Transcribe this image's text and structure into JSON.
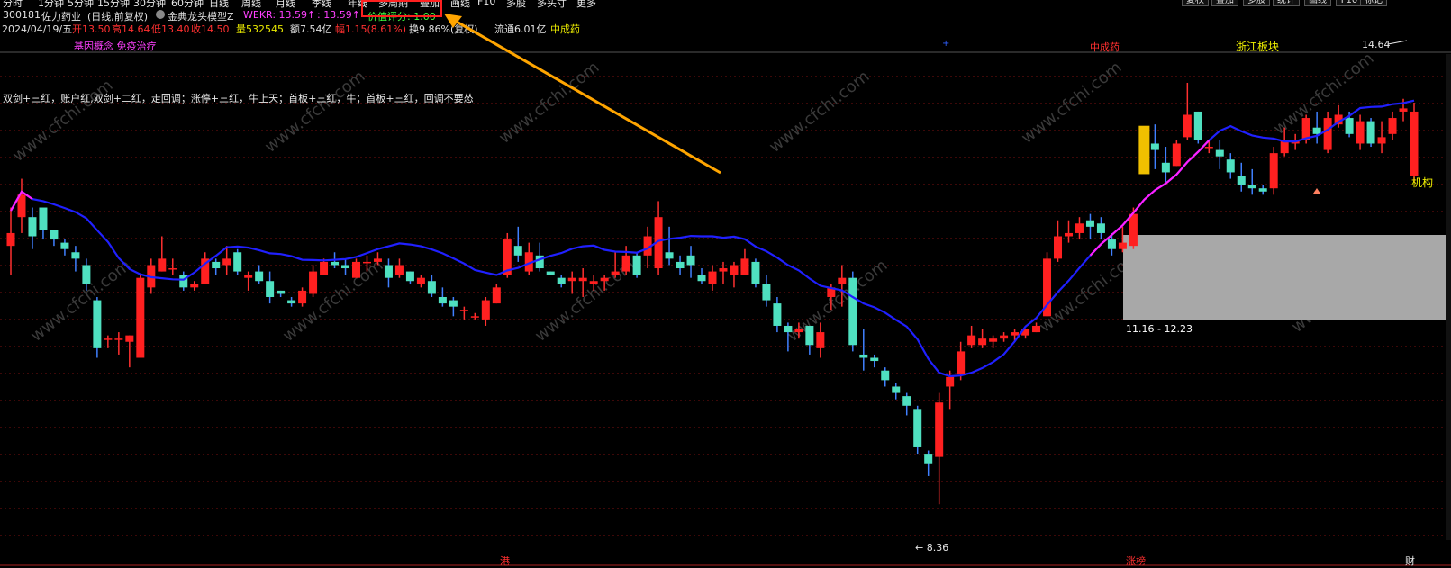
{
  "menubar": {
    "items": [
      "分时",
      "1分钟",
      "5分钟",
      "15分钟",
      "30分钟",
      "60分钟",
      "日线",
      "周线",
      "月线",
      "季线",
      "年线",
      "多周期",
      "叠加",
      "画线",
      "F10",
      "多股",
      "多头寸",
      "更多"
    ],
    "right_buttons": [
      "复权",
      "叠加",
      "多股",
      "统计",
      "画线",
      "F10",
      "标记"
    ]
  },
  "header": {
    "code": "300181",
    "name": "佐力药业",
    "period": "(日线,前复权)",
    "indicator": "金典龙头模型Z",
    "wekr_label": "WEKR: 13.59↑",
    "wekr_value": ": 13.59↑",
    "score": "价值评分: 1.00",
    "date": "2024/04/19/五",
    "open": "开13.50",
    "high": "高14.64",
    "low": "低13.40",
    "close": "收14.50",
    "volume": "量532545",
    "amount": "额7.54亿",
    "change": "幅1.15(8.61%)",
    "turnover": "换9.86%(复权)",
    "float": "流通6.01亿",
    "sector": "中成药"
  },
  "chart_labels": {
    "concepts": "基因概念 免疫治疗",
    "sector_tag": "中成药",
    "region_tag": "浙江板块",
    "strategy": "双剑+三红，账户红,双剑+二红，走回调；涨停+三红，牛上天；首板+三红，牛；首板+三红，回调不要怂",
    "high_mark": "14.64",
    "low_mark": "8.36",
    "range_label": "11.16 - 12.23",
    "jigou": "机构",
    "bottom_gang": "港",
    "bottom_zhangtingbang": "涨榜",
    "bottom_cai": "财",
    "watermark": "www.cfchi.com"
  },
  "colors": {
    "up": "#ff2020",
    "down": "#4fe0c0",
    "ma_blue": "#2020ff",
    "ma_magenta": "#ff20ff",
    "grid": "#7a1010",
    "arrow": "#ffa500"
  },
  "chart_data": {
    "type": "candlestick",
    "y_range": [
      7.8,
      15.4
    ],
    "candles": [
      [
        12.4,
        13.0,
        11.95,
        12.6
      ],
      [
        12.85,
        13.45,
        12.6,
        13.2
      ],
      [
        12.85,
        13.0,
        12.35,
        12.55
      ],
      [
        13.0,
        12.95,
        12.5,
        12.65
      ],
      [
        12.65,
        12.65,
        12.4,
        12.5
      ],
      [
        12.45,
        12.5,
        12.25,
        12.35
      ],
      [
        12.3,
        12.4,
        12.0,
        12.2
      ],
      [
        12.1,
        12.2,
        11.7,
        11.8
      ],
      [
        11.55,
        11.6,
        10.65,
        10.8
      ],
      [
        10.95,
        11.0,
        10.8,
        10.95
      ],
      [
        10.95,
        11.05,
        10.7,
        10.95
      ],
      [
        10.9,
        11.0,
        10.5,
        11.0
      ],
      [
        10.65,
        11.95,
        10.65,
        11.9
      ],
      [
        11.75,
        12.2,
        11.65,
        12.1
      ],
      [
        12.0,
        12.55,
        12.0,
        12.2
      ],
      [
        12.05,
        12.2,
        11.95,
        12.05
      ],
      [
        11.95,
        12.0,
        11.7,
        11.75
      ],
      [
        11.75,
        11.85,
        11.7,
        11.8
      ],
      [
        11.8,
        12.3,
        11.8,
        12.2
      ],
      [
        12.15,
        12.2,
        11.95,
        12.05
      ],
      [
        12.1,
        12.4,
        11.95,
        12.2
      ],
      [
        12.3,
        12.35,
        11.95,
        12.0
      ],
      [
        11.9,
        12.0,
        11.7,
        11.95
      ],
      [
        12.0,
        12.1,
        11.8,
        11.85
      ],
      [
        11.85,
        12.0,
        11.5,
        11.6
      ],
      [
        11.7,
        11.7,
        11.6,
        11.65
      ],
      [
        11.55,
        11.6,
        11.45,
        11.5
      ],
      [
        11.5,
        11.75,
        11.45,
        11.7
      ],
      [
        11.65,
        12.1,
        11.6,
        12.0
      ],
      [
        11.95,
        12.2,
        11.95,
        12.15
      ],
      [
        12.15,
        12.3,
        12.05,
        12.1
      ],
      [
        12.1,
        12.2,
        11.95,
        12.05
      ],
      [
        11.9,
        12.2,
        11.9,
        12.15
      ],
      [
        12.15,
        12.25,
        12.0,
        12.15
      ],
      [
        12.15,
        12.3,
        12.1,
        12.2
      ],
      [
        12.1,
        12.2,
        11.75,
        11.9
      ],
      [
        11.95,
        12.2,
        11.9,
        12.1
      ],
      [
        12.0,
        12.0,
        11.8,
        11.85
      ],
      [
        11.8,
        11.95,
        11.75,
        11.9
      ],
      [
        11.85,
        11.95,
        11.6,
        11.65
      ],
      [
        11.6,
        11.75,
        11.45,
        11.5
      ],
      [
        11.55,
        11.6,
        11.3,
        11.45
      ],
      [
        11.4,
        11.45,
        11.25,
        11.4
      ],
      [
        11.3,
        11.35,
        11.25,
        11.3
      ],
      [
        11.25,
        11.6,
        11.15,
        11.55
      ],
      [
        11.5,
        11.8,
        11.5,
        11.75
      ],
      [
        11.95,
        12.6,
        11.9,
        12.5
      ],
      [
        12.4,
        12.7,
        12.15,
        12.25
      ],
      [
        12.0,
        12.45,
        11.95,
        12.3
      ],
      [
        12.25,
        12.45,
        12.0,
        12.05
      ],
      [
        12.0,
        12.0,
        11.95,
        11.95
      ],
      [
        11.9,
        11.95,
        11.75,
        11.8
      ],
      [
        11.85,
        12.0,
        11.65,
        11.9
      ],
      [
        11.85,
        12.05,
        11.6,
        11.9
      ],
      [
        11.8,
        11.95,
        11.7,
        11.85
      ],
      [
        11.85,
        11.95,
        11.7,
        11.9
      ],
      [
        11.95,
        12.3,
        11.9,
        12.0
      ],
      [
        12.0,
        12.4,
        11.95,
        12.25
      ],
      [
        12.25,
        12.3,
        11.9,
        11.95
      ],
      [
        12.25,
        12.7,
        12.05,
        12.55
      ],
      [
        12.05,
        13.1,
        11.95,
        12.85
      ],
      [
        12.3,
        12.7,
        12.1,
        12.2
      ],
      [
        12.15,
        12.25,
        11.95,
        12.05
      ],
      [
        12.25,
        12.4,
        11.9,
        12.1
      ],
      [
        11.95,
        12.05,
        11.8,
        11.85
      ],
      [
        11.8,
        12.1,
        11.7,
        12.0
      ],
      [
        12.0,
        12.15,
        11.8,
        12.05
      ],
      [
        11.95,
        12.15,
        11.75,
        12.1
      ],
      [
        11.95,
        12.35,
        11.95,
        12.2
      ],
      [
        12.15,
        12.2,
        11.75,
        11.8
      ],
      [
        11.8,
        11.95,
        11.45,
        11.55
      ],
      [
        11.5,
        11.6,
        11.05,
        11.15
      ],
      [
        11.15,
        11.2,
        10.75,
        11.05
      ],
      [
        11.05,
        11.2,
        10.95,
        11.1
      ],
      [
        11.15,
        11.15,
        10.7,
        10.85
      ],
      [
        10.8,
        11.2,
        10.65,
        11.05
      ],
      [
        11.6,
        11.8,
        11.4,
        11.75
      ],
      [
        11.8,
        12.1,
        11.45,
        11.9
      ],
      [
        11.9,
        12.0,
        10.75,
        10.85
      ],
      [
        10.7,
        11.1,
        10.45,
        10.65
      ],
      [
        10.65,
        10.7,
        10.5,
        10.6
      ],
      [
        10.45,
        10.5,
        10.2,
        10.3
      ],
      [
        10.2,
        10.25,
        10.0,
        10.1
      ],
      [
        10.05,
        10.1,
        9.75,
        9.9
      ],
      [
        9.85,
        9.9,
        9.15,
        9.25
      ],
      [
        9.15,
        9.2,
        8.8,
        9.0
      ],
      [
        9.1,
        10.1,
        8.36,
        9.95
      ],
      [
        10.2,
        10.45,
        9.85,
        10.35
      ],
      [
        10.4,
        10.9,
        10.3,
        10.75
      ],
      [
        10.85,
        11.15,
        10.8,
        11.0
      ],
      [
        10.85,
        11.1,
        10.8,
        10.95
      ],
      [
        10.9,
        11.0,
        10.8,
        10.95
      ],
      [
        10.95,
        11.05,
        10.9,
        11.0
      ],
      [
        11.0,
        11.1,
        10.9,
        11.05
      ],
      [
        11.0,
        11.1,
        10.95,
        11.1
      ],
      [
        11.05,
        11.2,
        11.05,
        11.15
      ],
      [
        11.3,
        12.3,
        11.3,
        12.2
      ],
      [
        12.2,
        12.8,
        12.15,
        12.55
      ],
      [
        12.55,
        12.8,
        12.45,
        12.6
      ],
      [
        12.6,
        12.85,
        12.5,
        12.75
      ],
      [
        12.8,
        12.9,
        12.5,
        12.7
      ],
      [
        12.75,
        12.85,
        12.5,
        12.6
      ],
      [
        12.5,
        12.6,
        12.25,
        12.35
      ],
      [
        12.35,
        12.7,
        12.3,
        12.45
      ],
      [
        12.4,
        13.0,
        12.35,
        12.9
      ],
      [
        14.2,
        14.25,
        14.0,
        14.05
      ],
      [
        14.0,
        14.3,
        13.6,
        13.9
      ],
      [
        13.7,
        13.95,
        13.4,
        13.55
      ],
      [
        13.65,
        14.05,
        13.65,
        14.0
      ],
      [
        14.1,
        14.95,
        14.05,
        14.45
      ],
      [
        14.5,
        14.5,
        14.0,
        14.05
      ],
      [
        13.95,
        14.05,
        13.85,
        13.95
      ],
      [
        13.9,
        14.05,
        13.6,
        13.8
      ],
      [
        13.75,
        13.85,
        13.45,
        13.55
      ],
      [
        13.5,
        13.7,
        13.25,
        13.35
      ],
      [
        13.35,
        13.6,
        13.2,
        13.3
      ],
      [
        13.3,
        13.35,
        13.2,
        13.25
      ],
      [
        13.3,
        13.95,
        13.2,
        13.85
      ],
      [
        13.85,
        14.25,
        13.8,
        14.05
      ],
      [
        14.0,
        14.15,
        13.9,
        14.05
      ],
      [
        14.05,
        14.45,
        14.0,
        14.4
      ],
      [
        14.25,
        14.5,
        14.0,
        14.15
      ],
      [
        13.9,
        14.5,
        13.85,
        14.4
      ],
      [
        14.3,
        14.6,
        14.25,
        14.45
      ],
      [
        14.4,
        14.5,
        14.1,
        14.15
      ],
      [
        14.0,
        14.45,
        13.9,
        14.35
      ],
      [
        14.35,
        14.4,
        13.95,
        14.0
      ],
      [
        14.0,
        14.35,
        13.85,
        14.1
      ],
      [
        14.15,
        14.5,
        14.05,
        14.4
      ],
      [
        14.5,
        14.7,
        14.35,
        14.55
      ],
      [
        13.5,
        14.64,
        13.4,
        14.5
      ]
    ]
  }
}
